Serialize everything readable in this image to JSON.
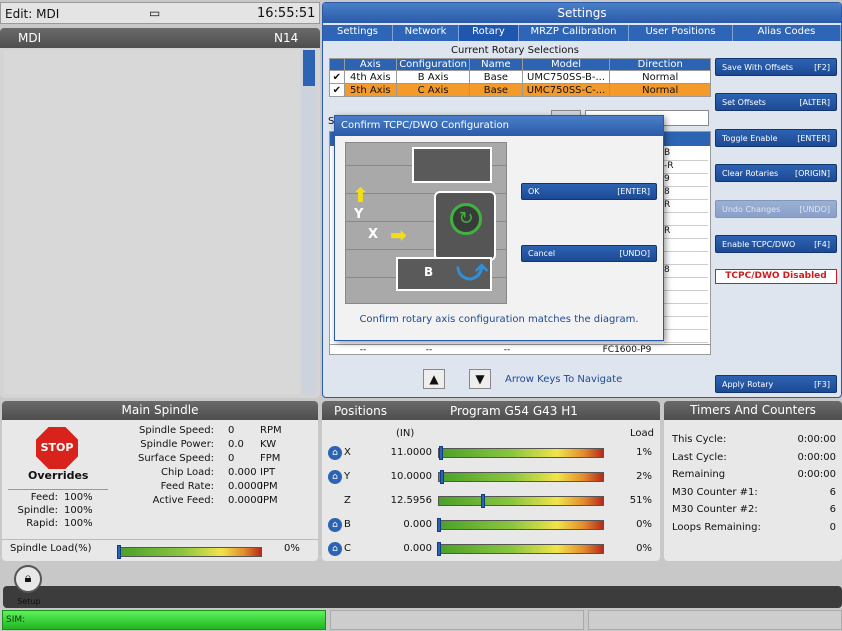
{
  "top_left": {
    "edit_mode": "Edit: MDI",
    "clock": "16:55:51",
    "cam_icon": "camera-icon"
  },
  "mdi": {
    "title": "MDI",
    "line": "N14"
  },
  "settings": {
    "title": "Settings",
    "tabs": [
      "Settings",
      "Network",
      "Rotary",
      "MRZP Calibration",
      "User Positions",
      "Alias Codes"
    ],
    "current_title": "Current Rotary Selections",
    "headers": [
      "Axis",
      "Configuration",
      "Name",
      "Model",
      "Direction"
    ],
    "rows": [
      {
        "check": "✔",
        "axis": "4th Axis",
        "config": "B Axis",
        "name": "Base",
        "model": "UMC750SS-B-...",
        "direction": "Normal"
      },
      {
        "check": "✔",
        "axis": "5th Axis",
        "config": "C Axis",
        "name": "Base",
        "model": "UMC750SS-C-...",
        "direction": "Normal"
      }
    ],
    "bg_list": [
      "B",
      "-R",
      "9",
      "8",
      "R",
      "",
      "R",
      "",
      "",
      "8",
      "",
      "",
      "",
      "",
      "",
      "FC1600-P9"
    ],
    "bg_last_row": [
      "--",
      "--",
      "--"
    ],
    "search_label": "S",
    "nav_hint": "Arrow Keys To Navigate",
    "buttons": [
      {
        "label": "Save With Offsets",
        "key": "[F2]"
      },
      {
        "label": "Set Offsets",
        "key": "[ALTER]"
      },
      {
        "label": "Toggle Enable",
        "key": "[ENTER]"
      },
      {
        "label": "Clear Rotaries",
        "key": "[ORIGIN]"
      },
      {
        "label": "Undo Changes",
        "key": "[UNDO]"
      },
      {
        "label": "Enable TCPC/DWO",
        "key": "[F4]"
      }
    ],
    "tcpc_status": "TCPC/DWO Disabled",
    "apply": {
      "label": "Apply Rotary",
      "key": "[F3]"
    }
  },
  "dialog": {
    "title": "Confirm TCPC/DWO Configuration",
    "ok_label": "OK",
    "ok_key": "[ENTER]",
    "cancel_label": "Cancel",
    "cancel_key": "[UNDO]",
    "message": "Confirm rotary axis configuration matches the diagram.",
    "diagram": {
      "y_label": "Y",
      "x_label": "X",
      "b_label": "B"
    }
  },
  "spindle": {
    "title": "Main Spindle",
    "stop_label": "STOP",
    "overrides_label": "Overrides",
    "overrides": [
      {
        "label": "Feed:",
        "value": "100%"
      },
      {
        "label": "Spindle:",
        "value": "100%"
      },
      {
        "label": "Rapid:",
        "value": "100%"
      }
    ],
    "stats": [
      {
        "label": "Spindle Speed:",
        "value": "0",
        "unit": "RPM"
      },
      {
        "label": "Spindle Power:",
        "value": "0.0",
        "unit": "KW"
      },
      {
        "label": "Surface Speed:",
        "value": "0",
        "unit": "FPM"
      },
      {
        "label": "Chip Load:",
        "value": "0.000",
        "unit": "IPT"
      },
      {
        "label": "Feed Rate:",
        "value": "0.0000",
        "unit": "IPM"
      },
      {
        "label": "Active Feed:",
        "value": "0.0000",
        "unit": "IPM"
      }
    ],
    "load_label": "Spindle Load(%)",
    "load_value": "0%"
  },
  "positions": {
    "title": "Positions",
    "program": "Program G54 G43 H1",
    "unit": "(IN)",
    "load_header": "Load",
    "axes": [
      {
        "axis": "X",
        "value": "11.0000",
        "load": "1%",
        "home": true,
        "frac": 0.01
      },
      {
        "axis": "Y",
        "value": "10.0000",
        "load": "2%",
        "home": true,
        "frac": 0.02
      },
      {
        "axis": "Z",
        "value": "12.5956",
        "load": "51%",
        "home": false,
        "frac": 0.27
      },
      {
        "axis": "B",
        "value": "0.000",
        "load": "0%",
        "home": true,
        "frac": 0.0
      },
      {
        "axis": "C",
        "value": "0.000",
        "load": "0%",
        "home": true,
        "frac": 0.0
      }
    ]
  },
  "timers": {
    "title": "Timers And Counters",
    "rows": [
      {
        "label": "This Cycle:",
        "value": "0:00:00"
      },
      {
        "label": "Last Cycle:",
        "value": "0:00:00"
      },
      {
        "label": "Remaining",
        "value": "0:00:00"
      },
      {
        "label": "M30 Counter #1:",
        "value": "6"
      },
      {
        "label": "M30 Counter #2:",
        "value": "6"
      },
      {
        "label": "Loops Remaining:",
        "value": "0"
      }
    ]
  },
  "bottom": {
    "setup_label": "Setup",
    "status": "SIM:"
  }
}
